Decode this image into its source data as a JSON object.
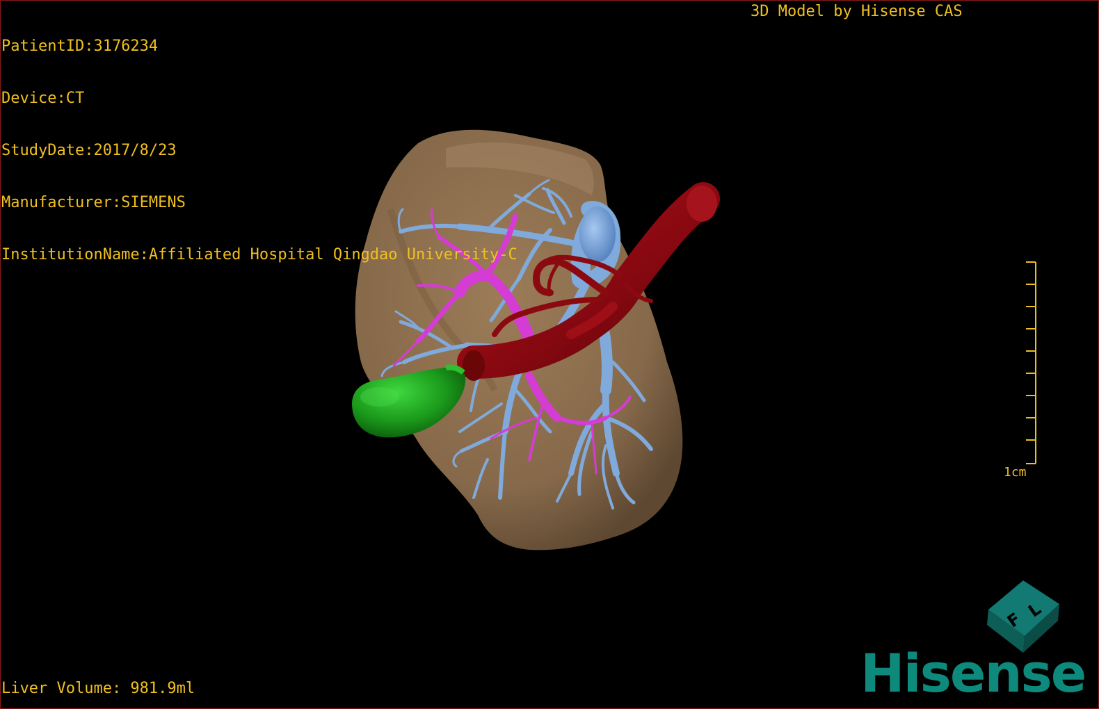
{
  "header": {
    "patient_id": "PatientID:3176234",
    "device": "Device:CT",
    "study_date": "StudyDate:2017/8/23",
    "manufacturer": "Manufacturer:SIEMENS",
    "institution": "InstitutionName:Affiliated Hospital Qingdao University-C"
  },
  "credit": "3D Model by Hisense CAS",
  "footer": {
    "liver_volume": "Liver Volume: 981.9ml"
  },
  "scale": {
    "label": "1cm"
  },
  "orientation_cube": {
    "letters": [
      "F",
      "L"
    ]
  },
  "logo": {
    "text": "Hisense"
  },
  "model": {
    "structures": [
      {
        "name": "liver",
        "color": "#8b6e4e"
      },
      {
        "name": "portal-vein",
        "color": "#7fa8d8"
      },
      {
        "name": "hepatic-artery-biliary",
        "color": "#d23cd2"
      },
      {
        "name": "aorta-ivc",
        "color": "#8a0a10"
      },
      {
        "name": "gallbladder",
        "color": "#1fa21f"
      }
    ]
  },
  "colors": {
    "overlay_text": "#f0c020",
    "border": "#8a1818",
    "logo": "#0e8a7c"
  }
}
